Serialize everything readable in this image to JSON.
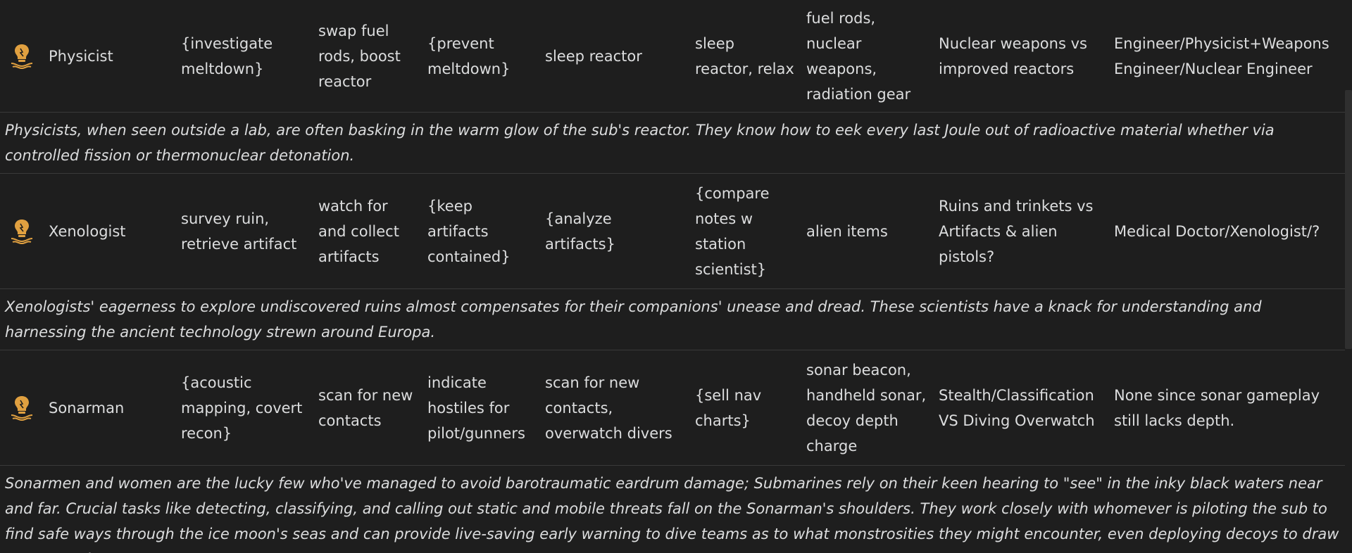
{
  "theme": {
    "background": "#1e1e1e",
    "text": "#dcddde",
    "icon_color": "#e0a040",
    "border": "#3a3a3a"
  },
  "roles": [
    {
      "icon": "lightbulb-icon",
      "name": "Physicist",
      "c1": "{investigate meltdown}",
      "c2": "swap fuel rods, boost reactor",
      "c3": "{prevent meltdown}",
      "c4": "sleep reactor",
      "c5": "sleep reactor, relax",
      "c6": "fuel rods, nuclear weapons, radiation gear",
      "c7": "Nuclear weapons vs improved reactors",
      "c8": "Engineer/Physicist+Weapons Engineer/Nuclear Engineer",
      "description": "Physicists, when seen outside a lab, are often basking in the warm glow of the sub's reactor. They know how to eek every last Joule out of radioactive material whether via controlled fission or thermonuclear detonation."
    },
    {
      "icon": "lightbulb-icon",
      "name": "Xenologist",
      "c1": "survey ruin, retrieve artifact",
      "c2": "watch for and collect artifacts",
      "c3": "{keep artifacts contained}",
      "c4": "{analyze artifacts}",
      "c5": "{compare notes w station scientist}",
      "c6": "alien items",
      "c7": "Ruins and trinkets vs Artifacts & alien pistols?",
      "c8": "Medical Doctor/Xenologist/?",
      "description": "Xenologists' eagerness to explore undiscovered ruins almost compensates for their companions' unease and dread. These scientists have a knack for understanding and harnessing the ancient technology strewn around Europa."
    },
    {
      "icon": "lightbulb-icon",
      "name": "Sonarman",
      "c1": "{acoustic mapping, covert recon}",
      "c2": "scan for new contacts",
      "c3": "indicate hostiles for pilot/gunners",
      "c4": "scan for new contacts, overwatch divers",
      "c5": "{sell nav charts}",
      "c6": "sonar beacon, handheld sonar, decoy depth charge",
      "c7": "Stealth/Classification VS Diving Overwatch",
      "c8": "None since sonar gameplay still lacks depth.",
      "description": "Sonarmen and women are the lucky few who've managed to avoid barotraumatic eardrum damage; Submarines rely on their keen hearing to \"see\" in the inky black waters near and far. Crucial tasks like detecting, classifying, and calling out static and mobile threats fall on the Sonarman's shoulders. They work closely with whomever is piloting the sub to find safe ways through the ice moon's seas and can provide live-saving early warning to dive teams as to what monstrosities they might encounter, even deploying decoys to draw away attackers."
    }
  ]
}
